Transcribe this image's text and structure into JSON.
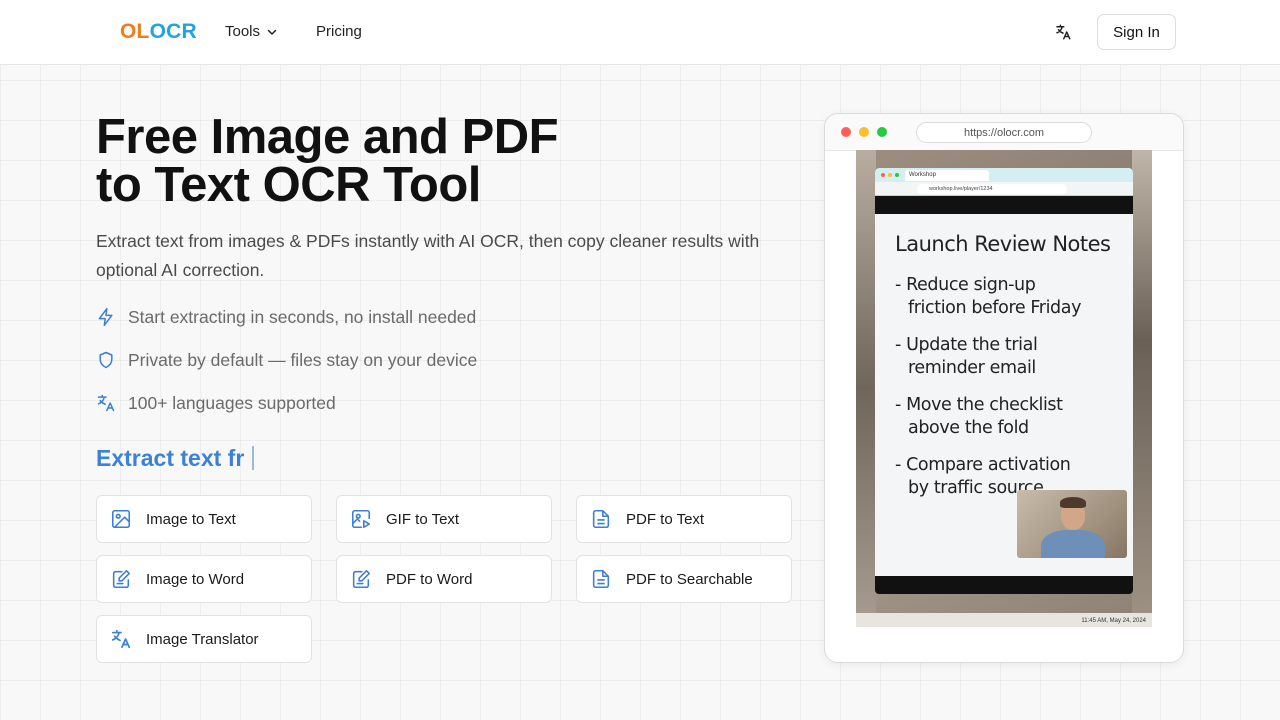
{
  "header": {
    "logo_part1": "OL",
    "logo_part2": "OCR",
    "nav_tools": "Tools",
    "nav_pricing": "Pricing",
    "signin": "Sign In",
    "language_icon": "translate-icon"
  },
  "hero": {
    "title_line1": "Free Image and PDF",
    "title_line2": "to Text OCR Tool",
    "description": "Extract text from images & PDFs instantly with AI OCR, then copy cleaner results with optional AI correction.",
    "features": [
      {
        "icon": "lightning-icon",
        "text": "Start extracting in seconds, no install needed"
      },
      {
        "icon": "shield-icon",
        "text": "Private by default — files stay on your device"
      },
      {
        "icon": "translate-icon",
        "text": "100+ languages supported"
      }
    ],
    "typing_text": "Extract text fr"
  },
  "tools": [
    {
      "icon": "image-icon",
      "label": "Image to Text"
    },
    {
      "icon": "gif-icon",
      "label": "GIF to Text"
    },
    {
      "icon": "document-icon",
      "label": "PDF to Text"
    },
    {
      "icon": "edit-document-icon",
      "label": "Image to Word"
    },
    {
      "icon": "edit-document-icon",
      "label": "PDF to Word"
    },
    {
      "icon": "document-icon",
      "label": "PDF to Searchable"
    },
    {
      "icon": "translate-icon",
      "label": "Image Translator"
    }
  ],
  "preview": {
    "url": "https://olocr.com",
    "inner_tab": "Workshop",
    "inner_url": "workshop.live/player/1234",
    "note_title": "Launch Review Notes",
    "notes": [
      {
        "line1": "- Reduce sign-up",
        "line2": "friction before Friday"
      },
      {
        "line1": "- Update the trial",
        "line2": "reminder email"
      },
      {
        "line1": "- Move the checklist",
        "line2": "above the fold"
      },
      {
        "line1": "- Compare activation",
        "line2": "by traffic source"
      }
    ],
    "timestamp": "11:45 AM, May 24, 2024"
  },
  "colors": {
    "accent": "#3b82d6",
    "logo_orange": "#f07c1e",
    "logo_blue": "#1fa4e0",
    "icon_blue": "#3b7dd8"
  }
}
